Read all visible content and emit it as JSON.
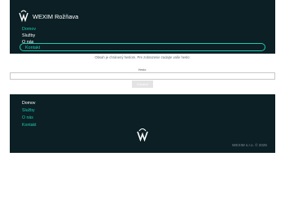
{
  "header": {
    "site_name": "WEXIM Rožňava",
    "nav": [
      {
        "label": "Domov"
      },
      {
        "label": "Služby"
      },
      {
        "label": "O nás"
      },
      {
        "label": "Kontakt"
      }
    ]
  },
  "notice": {
    "text": "Obsah je chránený heslom. Pre zobrazenie zadajte vaše heslo:"
  },
  "form": {
    "label": "Heslo:",
    "input_value": "",
    "submit_label": "Odoslať"
  },
  "footer": {
    "nav": [
      {
        "label": "Domov"
      },
      {
        "label": "Služby"
      },
      {
        "label": "O nás"
      },
      {
        "label": "Kontakt"
      }
    ],
    "copyright": "WEXIM s.r.o. © 2025"
  },
  "colors": {
    "dark_bg": "#0b1f24",
    "accent": "#1ec9b0"
  },
  "icons": [
    "wexim-logo-icon",
    "wexim-footer-logo-icon"
  ]
}
